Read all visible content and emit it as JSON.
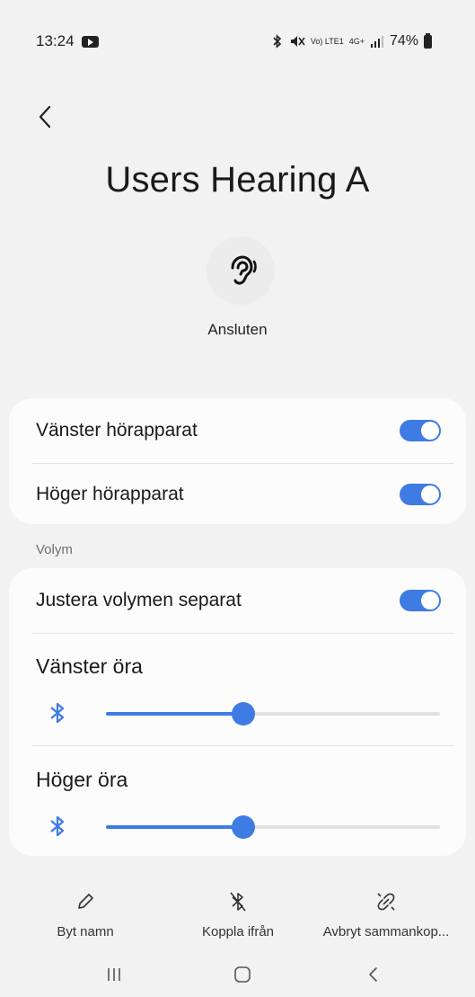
{
  "status_bar": {
    "time": "13:24",
    "indicators_text": "Vo) LTE1",
    "network_text": "4G+",
    "battery": "74%"
  },
  "header": {
    "title": "Users Hearing A",
    "connection_status": "Ansluten"
  },
  "hearing_card": {
    "left_label": "Vänster hörapparat",
    "left_on": true,
    "right_label": "Höger hörapparat",
    "right_on": true
  },
  "volume": {
    "section_label": "Volym",
    "separate_label": "Justera volymen separat",
    "separate_on": true,
    "left_ear_label": "Vänster öra",
    "left_ear_level": 0.41,
    "right_ear_label": "Höger öra",
    "right_ear_level": 0.41
  },
  "actions": {
    "rename": "Byt namn",
    "disconnect": "Koppla ifrån",
    "unpair": "Avbryt sammankop..."
  },
  "colors": {
    "accent": "#3e7be3",
    "background": "#f2f2f2",
    "card": "#fcfcfc"
  },
  "icons": {
    "back": "chevron-left-icon",
    "device": "ear-icon",
    "slider": "bluetooth-icon",
    "rename": "pencil-icon",
    "disconnect": "bluetooth-off-icon",
    "unpair": "unlink-icon"
  }
}
